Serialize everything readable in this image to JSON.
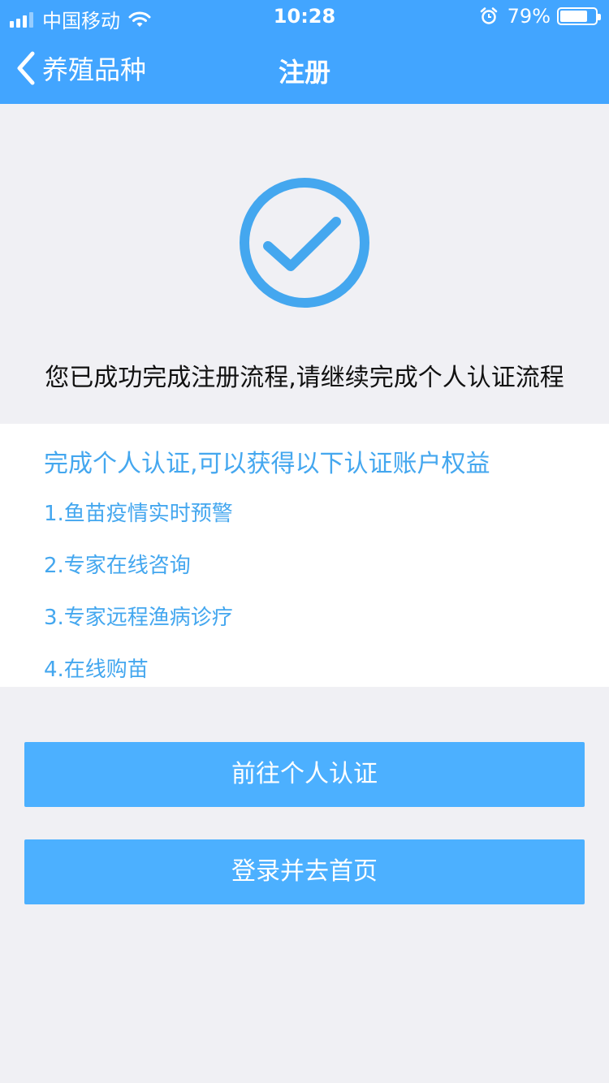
{
  "status_bar": {
    "carrier": "中国移动",
    "time": "10:28",
    "battery": "79%",
    "battery_level": 0.79
  },
  "nav": {
    "back_label": "养殖品种",
    "title": "注册"
  },
  "success_message": "您已成功完成注册流程,请继续完成个人认证流程",
  "benefits": {
    "title": "完成个人认证,可以获得以下认证账户权益",
    "items": [
      "1.鱼苗疫情实时预警",
      "2.专家在线咨询",
      "3.专家远程渔病诊疗",
      "4.在线购苗"
    ]
  },
  "buttons": {
    "verify": "前往个人认证",
    "login": "登录并去首页"
  },
  "colors": {
    "header": "#42a5ff",
    "accent": "#4cb0ff",
    "text_blue": "#44a7ef"
  }
}
